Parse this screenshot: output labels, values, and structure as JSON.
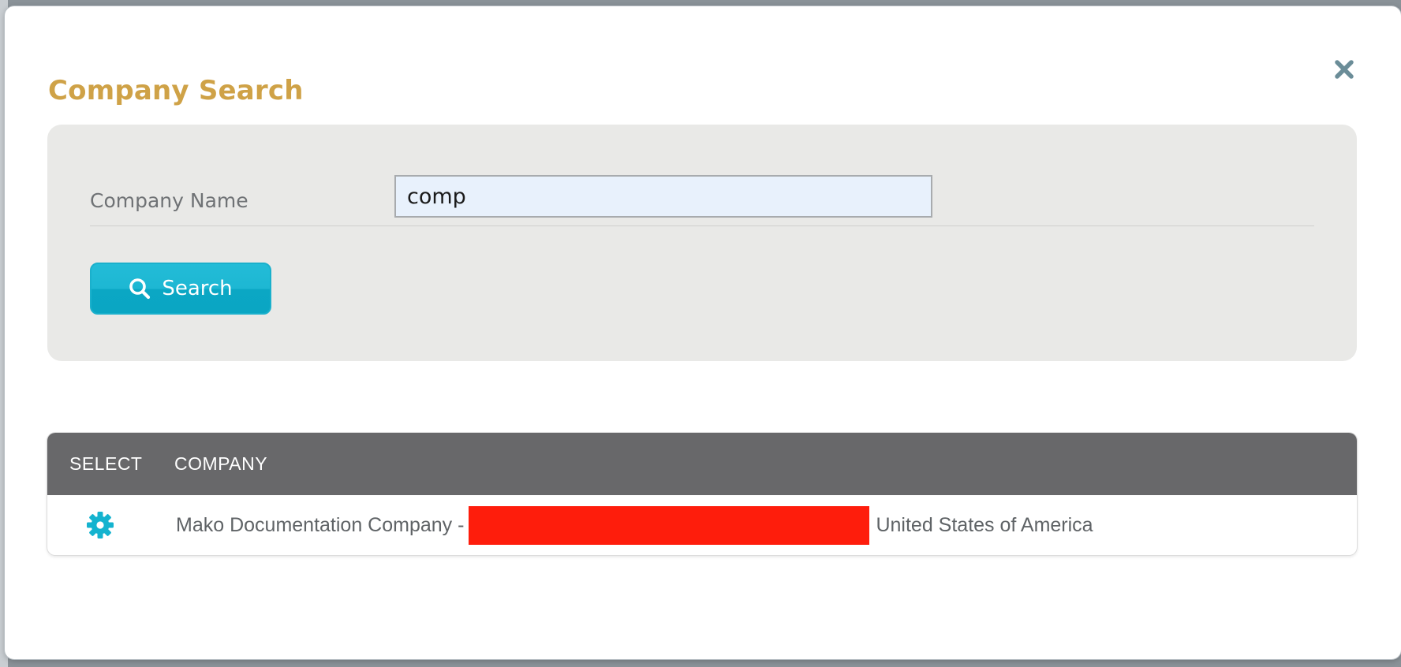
{
  "modal": {
    "title": "Company Search"
  },
  "search": {
    "label": "Company Name",
    "value": "comp",
    "button_label": "Search"
  },
  "table": {
    "columns": [
      "SELECT",
      "COMPANY"
    ],
    "rows": [
      {
        "company_prefix": "Mako Documentation Company -",
        "company_suffix": "United States of America"
      }
    ]
  },
  "colors": {
    "title": "#cfa247",
    "accent": "#14b3cf",
    "header_bg": "#68686a",
    "panel_bg": "#e9e9e7",
    "redaction": "#fe1d0c"
  },
  "icons": {
    "close": "close-icon",
    "search": "search-icon",
    "select": "gear-icon"
  }
}
